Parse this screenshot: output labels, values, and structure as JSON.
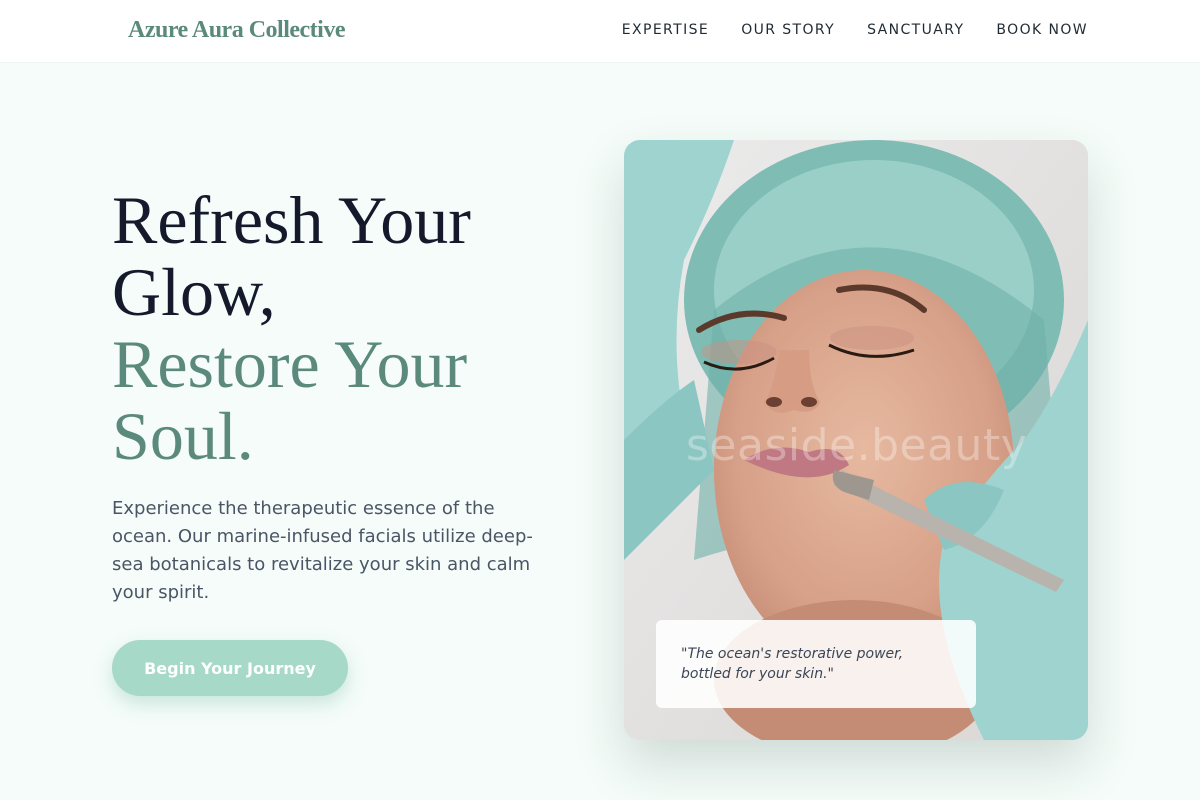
{
  "brand": {
    "name": "Azure Aura Collective"
  },
  "nav": {
    "items": [
      {
        "label": "EXPERTISE"
      },
      {
        "label": "OUR STORY"
      },
      {
        "label": "SANCTUARY"
      },
      {
        "label": "BOOK NOW"
      }
    ]
  },
  "hero": {
    "headline_line1": "Refresh Your Glow,",
    "headline_line2": "Restore Your Soul.",
    "description": "Experience the therapeutic essence of the ocean. Our marine-infused facials utilize deep-sea botanicals to revitalize your skin and calm your spirit.",
    "cta_label": "Begin Your Journey"
  },
  "image_card": {
    "watermark": "seaside.beauty",
    "quote": "\"The ocean's restorative power, bottled for your skin.\""
  },
  "colors": {
    "accent": "#5b8a7c",
    "button": "#a6d9c7",
    "page_background": "#f5fcf9",
    "headline_dark": "#141a2c"
  }
}
